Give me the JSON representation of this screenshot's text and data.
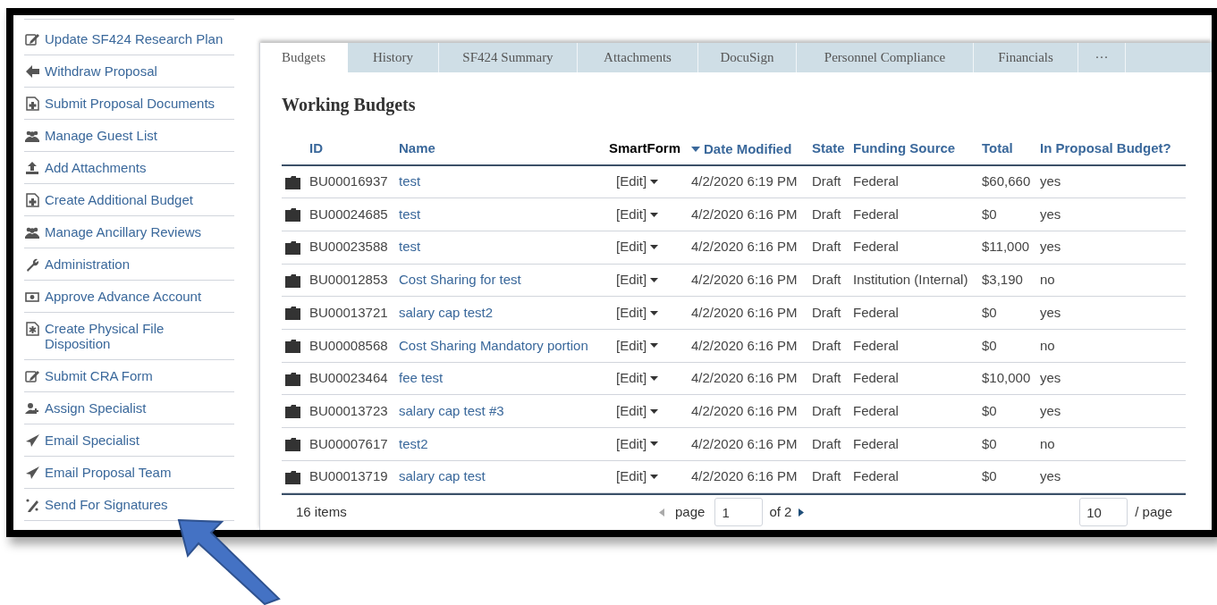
{
  "sidebar": {
    "items": [
      {
        "label": "Update SF424 Research Plan",
        "kind": "edit"
      },
      {
        "label": "Withdraw Proposal",
        "kind": "back"
      },
      {
        "label": "Submit Proposal Documents",
        "kind": "adddoc"
      },
      {
        "label": "Manage Guest List",
        "kind": "group"
      },
      {
        "label": "Add Attachments",
        "kind": "upload"
      },
      {
        "label": "Create Additional Budget",
        "kind": "adddoc"
      },
      {
        "label": "Manage Ancillary Reviews",
        "kind": "group"
      },
      {
        "label": "Administration",
        "kind": "wrench"
      },
      {
        "label": "Approve Advance Account",
        "kind": "money"
      },
      {
        "label": "Create Physical File Disposition",
        "kind": "filestar"
      },
      {
        "label": "Submit CRA Form",
        "kind": "edit"
      },
      {
        "label": "Assign Specialist",
        "kind": "useradd"
      },
      {
        "label": "Email Specialist",
        "kind": "send"
      },
      {
        "label": "Email Proposal Team",
        "kind": "send"
      },
      {
        "label": "Send For Signatures",
        "kind": "sign"
      }
    ]
  },
  "tabs": [
    {
      "label": "Budgets",
      "selected": true
    },
    {
      "label": "History",
      "selected": false
    },
    {
      "label": "SF424 Summary",
      "selected": false
    },
    {
      "label": "Attachments",
      "selected": false
    },
    {
      "label": "DocuSign",
      "selected": false
    },
    {
      "label": "Personnel Compliance",
      "selected": false
    },
    {
      "label": "Financials",
      "selected": false
    },
    {
      "label": "···",
      "selected": false
    }
  ],
  "heading": "Working Budgets",
  "table": {
    "columns": [
      {
        "label": "ID",
        "sortable": true,
        "sorted": false
      },
      {
        "label": "Name",
        "sortable": true,
        "sorted": false
      },
      {
        "label": "SmartForm",
        "sortable": false,
        "sorted": false
      },
      {
        "label": "Date Modified",
        "sortable": true,
        "sorted": true
      },
      {
        "label": "State",
        "sortable": true,
        "sorted": false
      },
      {
        "label": "Funding Source",
        "sortable": true,
        "sorted": false
      },
      {
        "label": "Total",
        "sortable": true,
        "sorted": false
      },
      {
        "label": "In Proposal Budget?",
        "sortable": true,
        "sorted": false
      }
    ],
    "rows": [
      {
        "id": "BU00016937",
        "name": "test",
        "smartform": "[Edit]",
        "date": "4/2/2020 6:19 PM",
        "state": "Draft",
        "funding": "Federal",
        "total": "$60,660",
        "in_budget": "yes"
      },
      {
        "id": "BU00024685",
        "name": "test",
        "smartform": "[Edit]",
        "date": "4/2/2020 6:16 PM",
        "state": "Draft",
        "funding": "Federal",
        "total": "$0",
        "in_budget": "yes"
      },
      {
        "id": "BU00023588",
        "name": "test",
        "smartform": "[Edit]",
        "date": "4/2/2020 6:16 PM",
        "state": "Draft",
        "funding": "Federal",
        "total": "$11,000",
        "in_budget": "yes"
      },
      {
        "id": "BU00012853",
        "name": "Cost Sharing for test",
        "smartform": "[Edit]",
        "date": "4/2/2020 6:16 PM",
        "state": "Draft",
        "funding": "Institution (Internal)",
        "total": "$3,190",
        "in_budget": "no"
      },
      {
        "id": "BU00013721",
        "name": "salary cap test2",
        "smartform": "[Edit]",
        "date": "4/2/2020 6:16 PM",
        "state": "Draft",
        "funding": "Federal",
        "total": "$0",
        "in_budget": "yes"
      },
      {
        "id": "BU00008568",
        "name": "Cost Sharing Mandatory portion",
        "smartform": "[Edit]",
        "date": "4/2/2020 6:16 PM",
        "state": "Draft",
        "funding": "Federal",
        "total": "$0",
        "in_budget": "no"
      },
      {
        "id": "BU00023464",
        "name": "fee test",
        "smartform": "[Edit]",
        "date": "4/2/2020 6:16 PM",
        "state": "Draft",
        "funding": "Federal",
        "total": "$10,000",
        "in_budget": "yes"
      },
      {
        "id": "BU00013723",
        "name": "salary cap test #3",
        "smartform": "[Edit]",
        "date": "4/2/2020 6:16 PM",
        "state": "Draft",
        "funding": "Federal",
        "total": "$0",
        "in_budget": "yes"
      },
      {
        "id": "BU00007617",
        "name": "test2",
        "smartform": "[Edit]",
        "date": "4/2/2020 6:16 PM",
        "state": "Draft",
        "funding": "Federal",
        "total": "$0",
        "in_budget": "no"
      },
      {
        "id": "BU00013719",
        "name": "salary cap test",
        "smartform": "[Edit]",
        "date": "4/2/2020 6:16 PM",
        "state": "Draft",
        "funding": "Federal",
        "total": "$0",
        "in_budget": "yes"
      }
    ]
  },
  "footer": {
    "count": "16 items",
    "page_label": "page",
    "page": "1",
    "page_of": "of 2",
    "per_page": "10",
    "per_page_label": "/ page"
  }
}
